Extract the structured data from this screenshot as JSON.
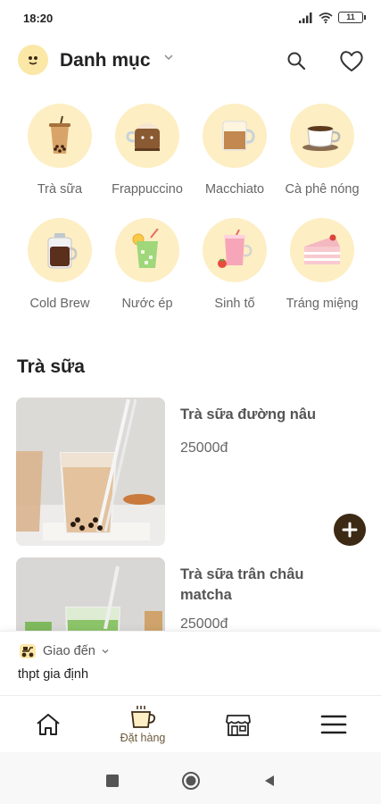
{
  "status_bar": {
    "time": "18:20",
    "battery": "11",
    "icons": [
      "signal-icon",
      "wifi-icon",
      "battery-icon"
    ]
  },
  "header": {
    "title": "Danh mục",
    "icons": [
      "brand-logo-icon",
      "chevron-down-icon",
      "search-icon",
      "heart-icon"
    ]
  },
  "categories": [
    {
      "label": "Trà sữa",
      "icon": "milk-tea-icon"
    },
    {
      "label": "Frappuccino",
      "icon": "frappuccino-icon"
    },
    {
      "label": "Macchiato",
      "icon": "macchiato-icon"
    },
    {
      "label": "Cà phê nóng",
      "icon": "hot-coffee-icon"
    },
    {
      "label": "Cold Brew",
      "icon": "cold-brew-icon"
    },
    {
      "label": "Nước ép",
      "icon": "juice-icon"
    },
    {
      "label": "Sinh tố",
      "icon": "smoothie-icon"
    },
    {
      "label": "Tráng miệng",
      "icon": "dessert-icon"
    }
  ],
  "section": {
    "title": "Trà sữa"
  },
  "products": [
    {
      "name": "Trà sữa đường nâu",
      "price": "25000đ",
      "image": "brown-sugar-milk-tea-photo"
    },
    {
      "name": "Trà sữa trân châu matcha",
      "price": "25000đ",
      "image": "matcha-milk-tea-photo"
    }
  ],
  "delivery": {
    "label": "Giao đến",
    "address": "thpt gia định",
    "icon": "delivery-scooter-icon"
  },
  "bottom_nav": {
    "items": [
      {
        "label": "",
        "icon": "home-icon"
      },
      {
        "label": "Đặt hàng",
        "icon": "order-cup-icon"
      },
      {
        "label": "",
        "icon": "store-icon"
      },
      {
        "label": "",
        "icon": "menu-icon"
      }
    ]
  },
  "colors": {
    "accent_dark": "#3d2a14",
    "category_bg": "#fdeec3",
    "nav_label": "#6b5a3b"
  }
}
